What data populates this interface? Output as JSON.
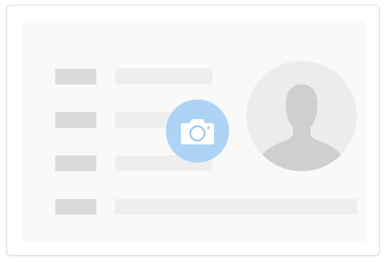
{
  "card": {
    "rows": [
      {
        "label_placeholder": "label-1",
        "value_placeholder": "value-1"
      },
      {
        "label_placeholder": "label-2",
        "value_placeholder": "value-2"
      },
      {
        "label_placeholder": "label-3",
        "value_placeholder": "value-3"
      },
      {
        "label_placeholder": "label-4",
        "value_placeholder": "value-4"
      }
    ],
    "avatar": {
      "icon": "person-silhouette-icon"
    },
    "upload_button": {
      "icon": "camera-icon"
    }
  },
  "colors": {
    "card_border": "#dcdcdc",
    "panel_background": "#f9f9f9",
    "label_placeholder": "#dadada",
    "value_placeholder": "#eeeeee",
    "avatar_background": "#ececec",
    "avatar_silhouette": "#cfcfcf",
    "camera_button": "#a0cdf5",
    "camera_icon": "#ffffff"
  }
}
